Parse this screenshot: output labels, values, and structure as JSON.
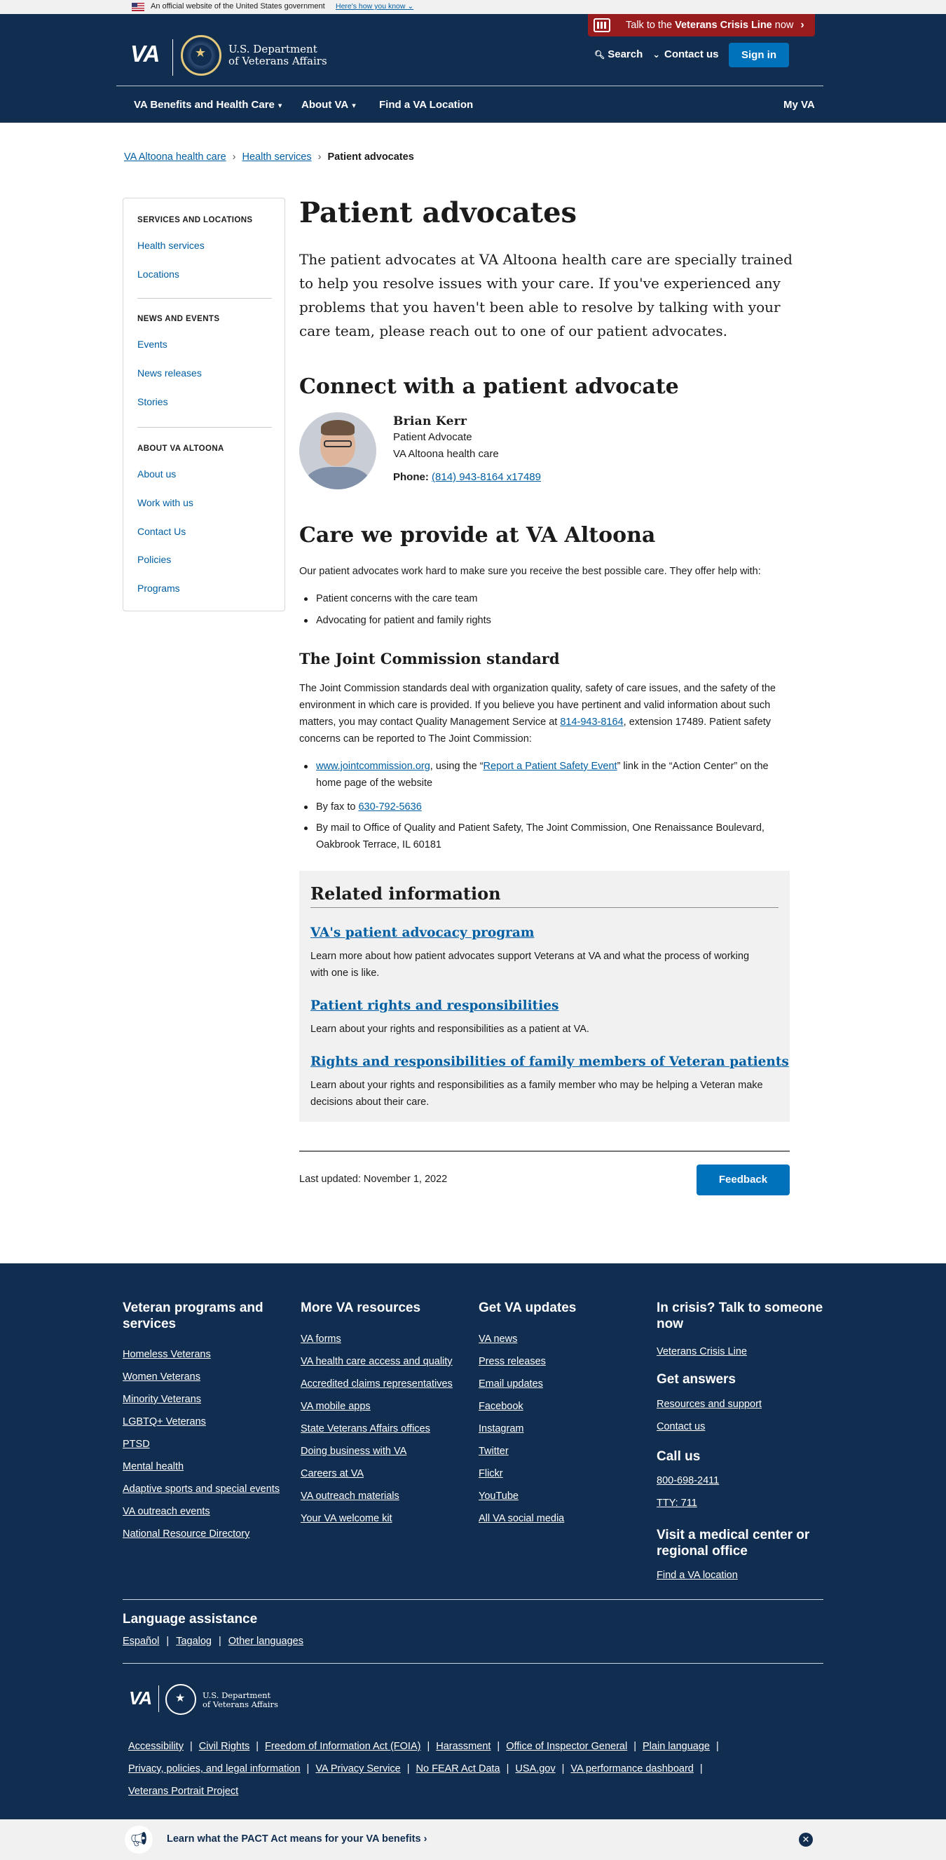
{
  "official_banner": {
    "text": "An official website of the United States government",
    "link": "Here's how you know"
  },
  "header": {
    "crisis_prefix": "Talk to the ",
    "crisis_bold": "Veterans Crisis Line",
    "crisis_suffix": " now",
    "logo_va": "VA",
    "logo_dept_line1": "U.S. Department",
    "logo_dept_line2": "of Veterans Affairs",
    "search": "Search",
    "contact": "Contact us",
    "signin": "Sign in",
    "nav": {
      "benefits": "VA Benefits and Health Care",
      "about": "About VA",
      "find": "Find a VA Location",
      "myva": "My VA"
    }
  },
  "breadcrumb": [
    "VA Altoona health care",
    "Health services",
    "Patient advocates"
  ],
  "sidebar": {
    "sections": [
      {
        "title": "SERVICES AND LOCATIONS",
        "items": [
          "Health services",
          "Locations"
        ]
      },
      {
        "title": "NEWS AND EVENTS",
        "items": [
          "Events",
          "News releases",
          "Stories"
        ]
      },
      {
        "title": "ABOUT VA ALTOONA",
        "items": [
          "About us",
          "Work with us",
          "Contact Us",
          "Policies",
          "Programs"
        ]
      }
    ]
  },
  "main": {
    "title": "Patient advocates",
    "intro": "The patient advocates at VA Altoona health care are specially trained to help you resolve issues with your care. If you've experienced any problems that you haven't been able to resolve by talking with your care team, please reach out to one of our patient advocates.",
    "connect_heading": "Connect with a patient advocate",
    "advocate": {
      "name": "Brian Kerr",
      "role": "Patient Advocate",
      "facility": "VA Altoona health care",
      "phone_label": "Phone:",
      "phone": "(814) 943-8164 x17489"
    },
    "care_heading": "Care we provide at VA Altoona",
    "care_intro": "Our patient advocates work hard to make sure you receive the best possible care. They offer help with:",
    "care_items": [
      "Patient concerns with the care team",
      "Advocating for patient and family rights"
    ],
    "tjc_heading": "The Joint Commission standard",
    "tjc_para_1": "The Joint Commission standards deal with organization quality, safety of care issues, and the safety of the environment in which care is provided. If you believe you have pertinent and valid information about such matters, you may contact Quality Management Service at ",
    "tjc_para_phone": "814-943-8164",
    "tjc_para_2": ", extension 17489. Patient safety concerns can be reported to The Joint Commission:",
    "tjc_b1_link": "www.jointcommission.org",
    "tjc_b1_mid": ", using the “",
    "tjc_b1_link2": "Report a Patient Safety Event",
    "tjc_b1_end": "” link in the “Action Center” on the home page of the website",
    "tjc_b2_pre": "By fax to ",
    "tjc_b2_fax": "630-792-5636",
    "tjc_b3": "By mail to Office of Quality and Patient Safety, The Joint Commission, One Renaissance Boulevard, Oakbrook Terrace, IL 60181"
  },
  "related": {
    "title": "Related information",
    "items": [
      {
        "link": "VA's patient advocacy program",
        "desc": "Learn more about how patient advocates support Veterans at VA and what the process of working with one is like."
      },
      {
        "link": "Patient rights and responsibilities",
        "desc": "Learn about your rights and responsibilities as a patient at VA."
      },
      {
        "link": "Rights and responsibilities of family members of Veteran patients",
        "desc": "Learn about your rights and responsibilities as a family member who may be helping a Veteran make decisions about their care."
      }
    ]
  },
  "updated": "Last updated: November 1, 2022",
  "feedback": "Feedback",
  "footer": {
    "col1": {
      "title": "Veteran programs and services",
      "links": [
        "Homeless Veterans",
        "Women Veterans",
        "Minority Veterans",
        "LGBTQ+ Veterans",
        "PTSD",
        "Mental health",
        "Adaptive sports and special events",
        "VA outreach events",
        "National Resource Directory"
      ]
    },
    "col2": {
      "title": "More VA resources",
      "links": [
        "VA forms",
        "VA health care access and quality",
        "Accredited claims representatives",
        "VA mobile apps",
        "State Veterans Affairs offices",
        "Doing business with VA",
        "Careers at VA",
        "VA outreach materials",
        "Your VA welcome kit"
      ]
    },
    "col3": {
      "title": "Get VA updates",
      "links": [
        "VA news",
        "Press releases",
        "Email updates",
        "Facebook",
        "Instagram",
        "Twitter",
        "Flickr",
        "YouTube",
        "All VA social media"
      ]
    },
    "col4": {
      "crisis_title": "In crisis? Talk to someone now",
      "crisis_link": "Veterans Crisis Line",
      "answers_title": "Get answers",
      "answers_links": [
        "Resources and support",
        "Contact us"
      ],
      "call_title": "Call us",
      "call_links": [
        "800-698-2411",
        "TTY: 711"
      ],
      "visit_title": "Visit a medical center or regional office",
      "visit_link": "Find a VA location"
    },
    "language_title": "Language assistance",
    "languages": [
      "Español",
      "Tagalog",
      "Other languages"
    ],
    "bottom_links": [
      "Accessibility",
      "Civil Rights",
      "Freedom of Information Act (FOIA)",
      "Harassment",
      "Office of Inspector General",
      "Plain language",
      "Privacy, policies, and legal information",
      "VA Privacy Service",
      "No FEAR Act Data",
      "USA.gov",
      "VA performance dashboard",
      "Veterans Portrait Project"
    ]
  },
  "pact_banner": "Learn what the PACT Act means for your VA benefits"
}
